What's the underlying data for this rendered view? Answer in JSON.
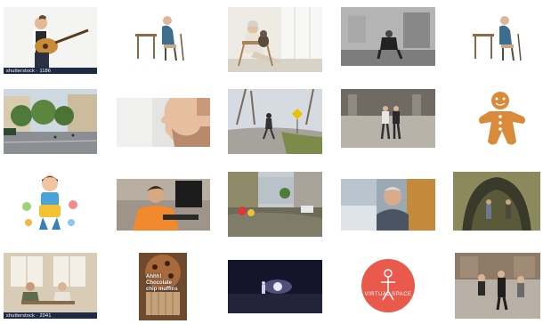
{
  "grid": {
    "thumbnails": [
      {
        "id": "guitar-man",
        "watermark": "shutterstock · 1186"
      },
      {
        "id": "old-man-desk"
      },
      {
        "id": "woman-dog-chair"
      },
      {
        "id": "man-sitting-street"
      },
      {
        "id": "old-man-desk-2"
      },
      {
        "id": "city-street"
      },
      {
        "id": "man-profile"
      },
      {
        "id": "person-walking-road"
      },
      {
        "id": "couple-plaza"
      },
      {
        "id": "gingerbread-man"
      },
      {
        "id": "cartoon-girl"
      },
      {
        "id": "boy-computer"
      },
      {
        "id": "flooded-street"
      },
      {
        "id": "old-man-portrait"
      },
      {
        "id": "tunnel-people"
      },
      {
        "id": "men-cafe",
        "watermark": "shutterstock · 2041"
      },
      {
        "id": "muffin-meme",
        "overlay_text": "Ahhh! Chocolate chip muffins"
      },
      {
        "id": "night-road"
      },
      {
        "id": "logo-circle",
        "logo_text": "VIRTUAL SPACE"
      },
      {
        "id": "men-sidewalk"
      }
    ]
  },
  "colors": {
    "stock_bar": "#1e2a44",
    "logo_red": "#e95a4c"
  }
}
